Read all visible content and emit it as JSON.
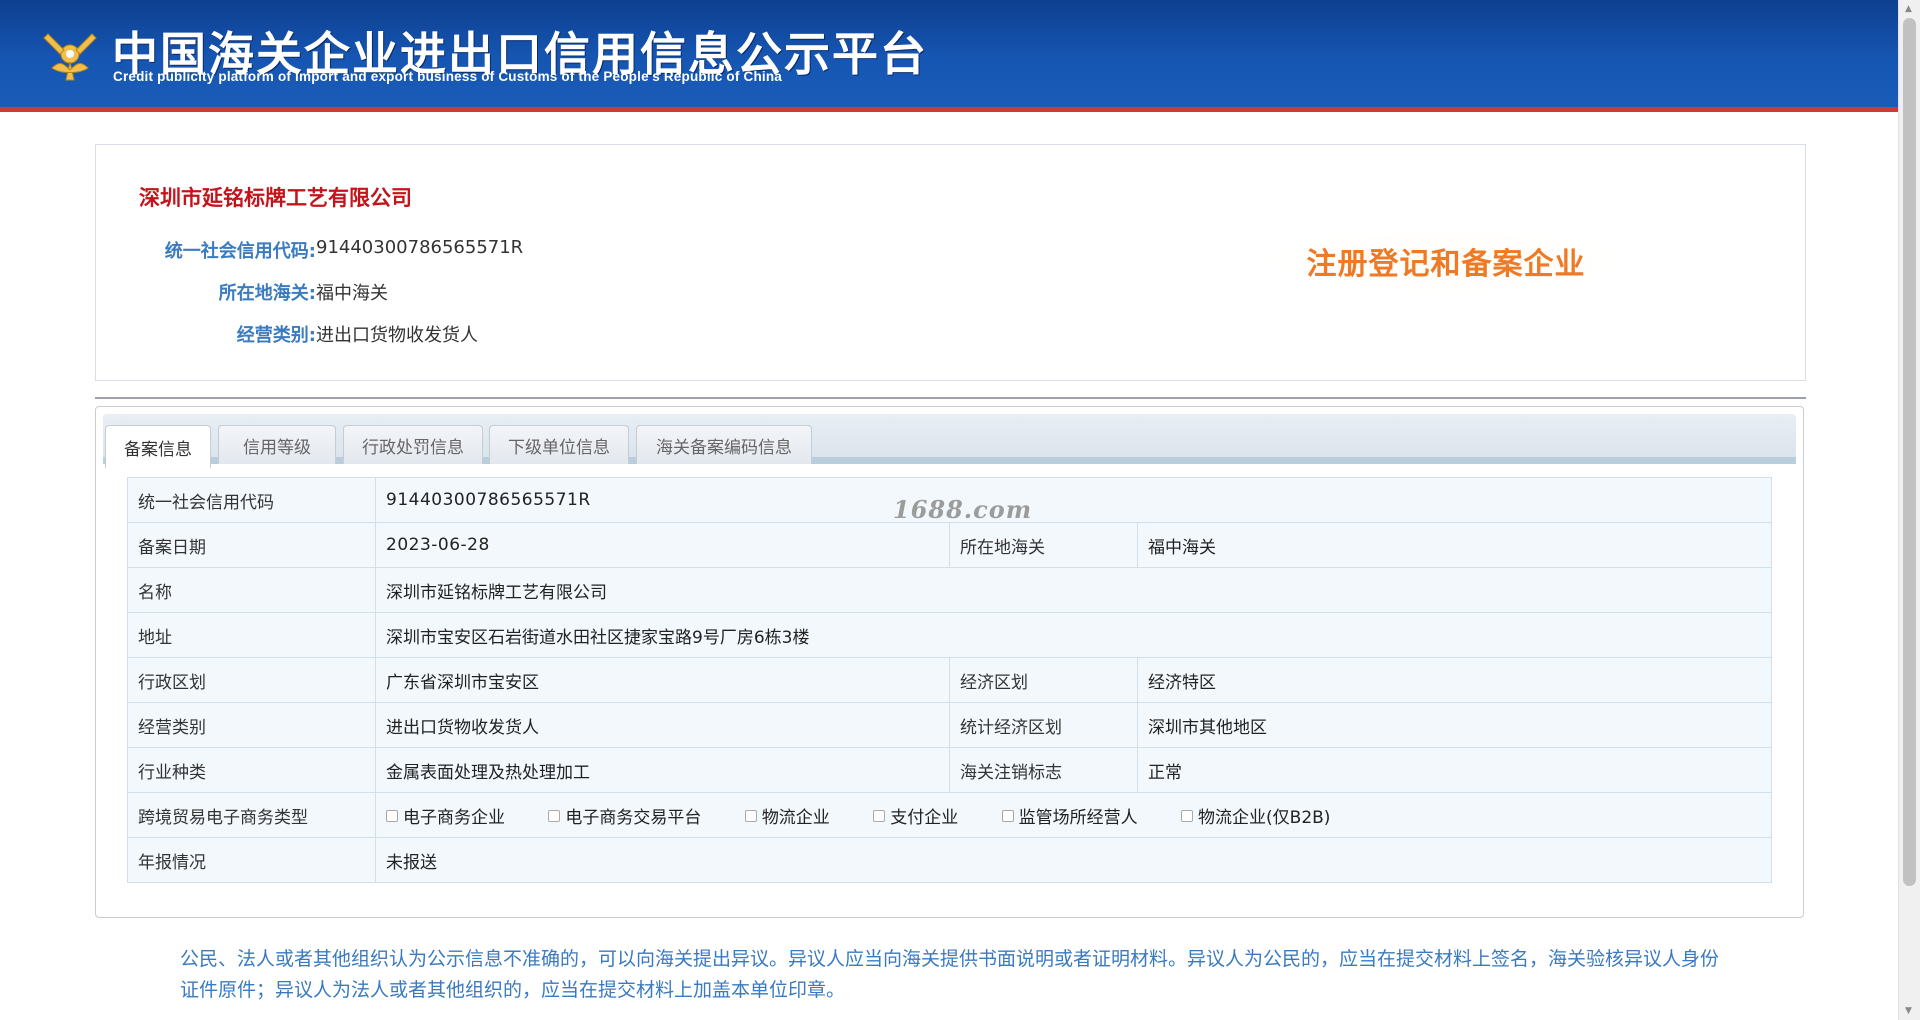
{
  "header": {
    "title": "中国海关企业进出口信用信息公示平台",
    "subtitle": "Credit publicity platform of import and export business of Customs of the People's Republic of China",
    "logo_icon": "customs-emblem-icon"
  },
  "company": {
    "name": "深圳市延铭标牌工艺有限公司",
    "fields": [
      {
        "label": "统一社会信用代码:",
        "value": "91440300786565571R"
      },
      {
        "label": "所在地海关:",
        "value": "福中海关"
      },
      {
        "label": "经营类别:",
        "value": "进出口货物收发货人"
      }
    ],
    "stamp": "注册登记和备案企业",
    "stamp_color": "#ef7a25"
  },
  "tabs": [
    {
      "label": "备案信息",
      "active": true
    },
    {
      "label": "信用等级",
      "active": false
    },
    {
      "label": "行政处罚信息",
      "active": false
    },
    {
      "label": "下级单位信息",
      "active": false
    },
    {
      "label": "海关备案编码信息",
      "active": false
    }
  ],
  "table": {
    "credit_code": {
      "label": "统一社会信用代码",
      "value": "91440300786565571R"
    },
    "record_date": {
      "label": "备案日期",
      "value": "2023-06-28"
    },
    "customs": {
      "label": "所在地海关",
      "value": "福中海关"
    },
    "name": {
      "label": "名称",
      "value": "深圳市延铭标牌工艺有限公司"
    },
    "address": {
      "label": "地址",
      "value": "深圳市宝安区石岩街道水田社区捷家宝路9号厂房6栋3楼"
    },
    "admin_region": {
      "label": "行政区划",
      "value": "广东省深圳市宝安区"
    },
    "econ_region": {
      "label": "经济区划",
      "value": "经济特区"
    },
    "business_type": {
      "label": "经营类别",
      "value": "进出口货物收发货人"
    },
    "stat_region": {
      "label": "统计经济区划",
      "value": "深圳市其他地区"
    },
    "industry": {
      "label": "行业种类",
      "value": "金属表面处理及热处理加工"
    },
    "cancel_flag": {
      "label": "海关注销标志",
      "value": "正常"
    },
    "ecommerce": {
      "label": "跨境贸易电子商务类型",
      "options": [
        "电子商务企业",
        "电子商务交易平台",
        "物流企业",
        "支付企业",
        "监管场所经营人",
        "物流企业(仅B2B)"
      ]
    },
    "annual_report": {
      "label": "年报情况",
      "value": "未报送"
    }
  },
  "watermark": "1688.com",
  "notice": "公民、法人或者其他组织认为公示信息不准确的，可以向海关提出异议。异议人应当向海关提供书面说明或者证明材料。异议人为公民的，应当在提交材料上签名，海关验核异议人身份证件原件；异议人为法人或者其他组织的，应当在提交材料上加盖本单位印章。",
  "colors": {
    "header_blue": "#1656b3",
    "header_red_line": "#d23a3a",
    "company_name": "#c4141b",
    "label_blue": "#3b7bc0"
  }
}
